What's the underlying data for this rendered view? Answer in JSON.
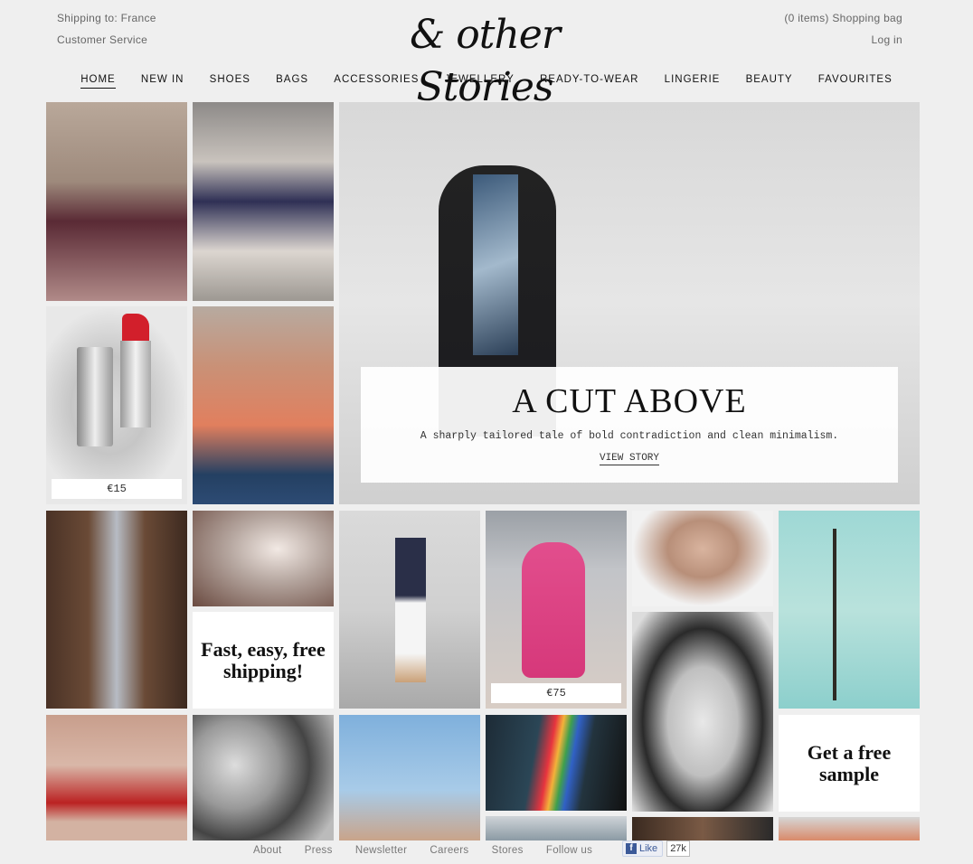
{
  "header": {
    "shipping": "Shipping to: France",
    "customer_service": "Customer Service",
    "bag": "(0 items) Shopping bag",
    "login": "Log in",
    "logo": "& other Stories"
  },
  "nav": [
    "HOME",
    "NEW IN",
    "SHOES",
    "BAGS",
    "ACCESSORIES",
    "JEWELLERY",
    "READY-TO-WEAR",
    "LINGERIE",
    "BEAUTY",
    "FAVOURITES"
  ],
  "hero": {
    "title": "A CUT ABOVE",
    "subtitle": "A sharply tailored tale of bold contradiction and clean minimalism.",
    "link": "VIEW STORY"
  },
  "prices": {
    "lipstick": "€15",
    "pink_dress": "€75"
  },
  "promos": {
    "shipping": "Fast, easy, free shipping!",
    "sample": "Get a free sample"
  },
  "footer": {
    "links": [
      "About",
      "Press",
      "Newsletter",
      "Careers",
      "Stores",
      "Follow us"
    ],
    "like_label": "Like",
    "like_count": "27k"
  },
  "colors": {
    "accent_fb": "#3b5998",
    "background": "#efefef"
  }
}
